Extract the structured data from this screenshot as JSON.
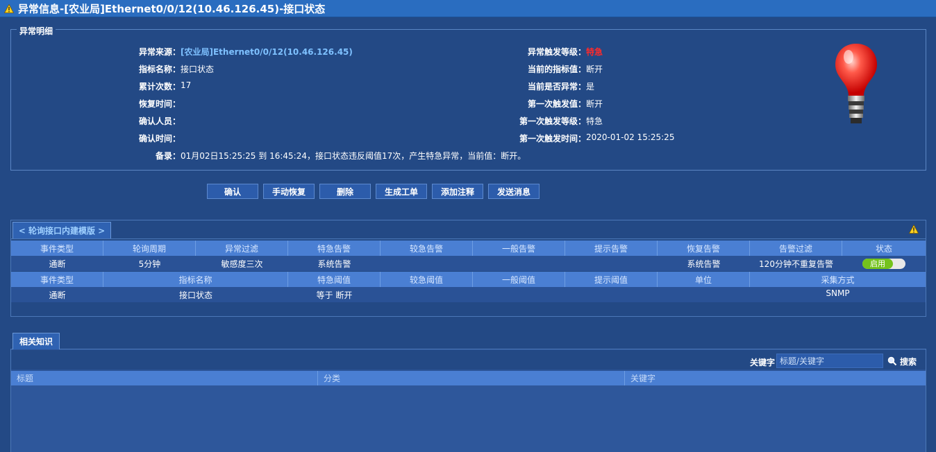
{
  "window": {
    "title": "异常信息-[农业局]Ethernet0/0/12(10.46.126.45)-接口状态",
    "icon": "warning-icon"
  },
  "detail": {
    "legend": "异常明细",
    "left": [
      {
        "label": "异常来源：",
        "value": "[农业局]Ethernet0/0/12(10.46.126.45)"
      },
      {
        "label": "指标名称：",
        "value": "接口状态"
      },
      {
        "label": "累计次数：",
        "value": "17"
      },
      {
        "label": "恢复时间：",
        "value": ""
      },
      {
        "label": "确认人员：",
        "value": ""
      },
      {
        "label": "确认时间：",
        "value": ""
      }
    ],
    "right": [
      {
        "label": "异常触发等级：",
        "value": "特急"
      },
      {
        "label": "当前的指标值：",
        "value": "断开"
      },
      {
        "label": "当前是否异常：",
        "value": "是"
      },
      {
        "label": "第一次触发值：",
        "value": "断开"
      },
      {
        "label": "第一次触发等级：",
        "value": "特急"
      },
      {
        "label": "第一次触发时间：",
        "value": "2020-01-02 15:25:25"
      }
    ],
    "note": {
      "label": "备录：",
      "value": "01月02日15:25:25 到 16:45:24，接口状态违反阈值17次，产生特急异常，当前值：断开。"
    },
    "status_icon": "red-lightbulb-icon",
    "colors": {
      "link": "#7ec1ff",
      "alert": "#ff2a2a"
    }
  },
  "actions": [
    "确认",
    "手动恢复",
    "删除",
    "生成工单",
    "添加注释",
    "发送消息"
  ],
  "template": {
    "tab_label": "< 轮询接口内建模版 >",
    "table1": {
      "headers": [
        "事件类型",
        "轮询周期",
        "异常过滤",
        "特急告警",
        "较急告警",
        "一般告警",
        "提示告警",
        "恢复告警",
        "告警过滤",
        "状态"
      ],
      "row": [
        "通断",
        "5分钟",
        "敏感度三次",
        "系统告警",
        "",
        "",
        "",
        "系统告警",
        "120分钟不重复告警"
      ],
      "status_toggle": "启用"
    },
    "table2": {
      "headers": [
        "事件类型",
        "指标名称",
        "特急阈值",
        "较急阈值",
        "一般阈值",
        "提示阈值",
        "单位",
        "采集方式"
      ],
      "row": [
        "通断",
        "接口状态",
        "等于 断开",
        "",
        "",
        "",
        "",
        "SNMP"
      ]
    }
  },
  "knowledge": {
    "tab_label": "相关知识",
    "keyword_label": "关键字",
    "search_placeholder": "标题/关键字",
    "search_label": "搜索",
    "columns": [
      "标题",
      "分类",
      "关键字"
    ]
  }
}
